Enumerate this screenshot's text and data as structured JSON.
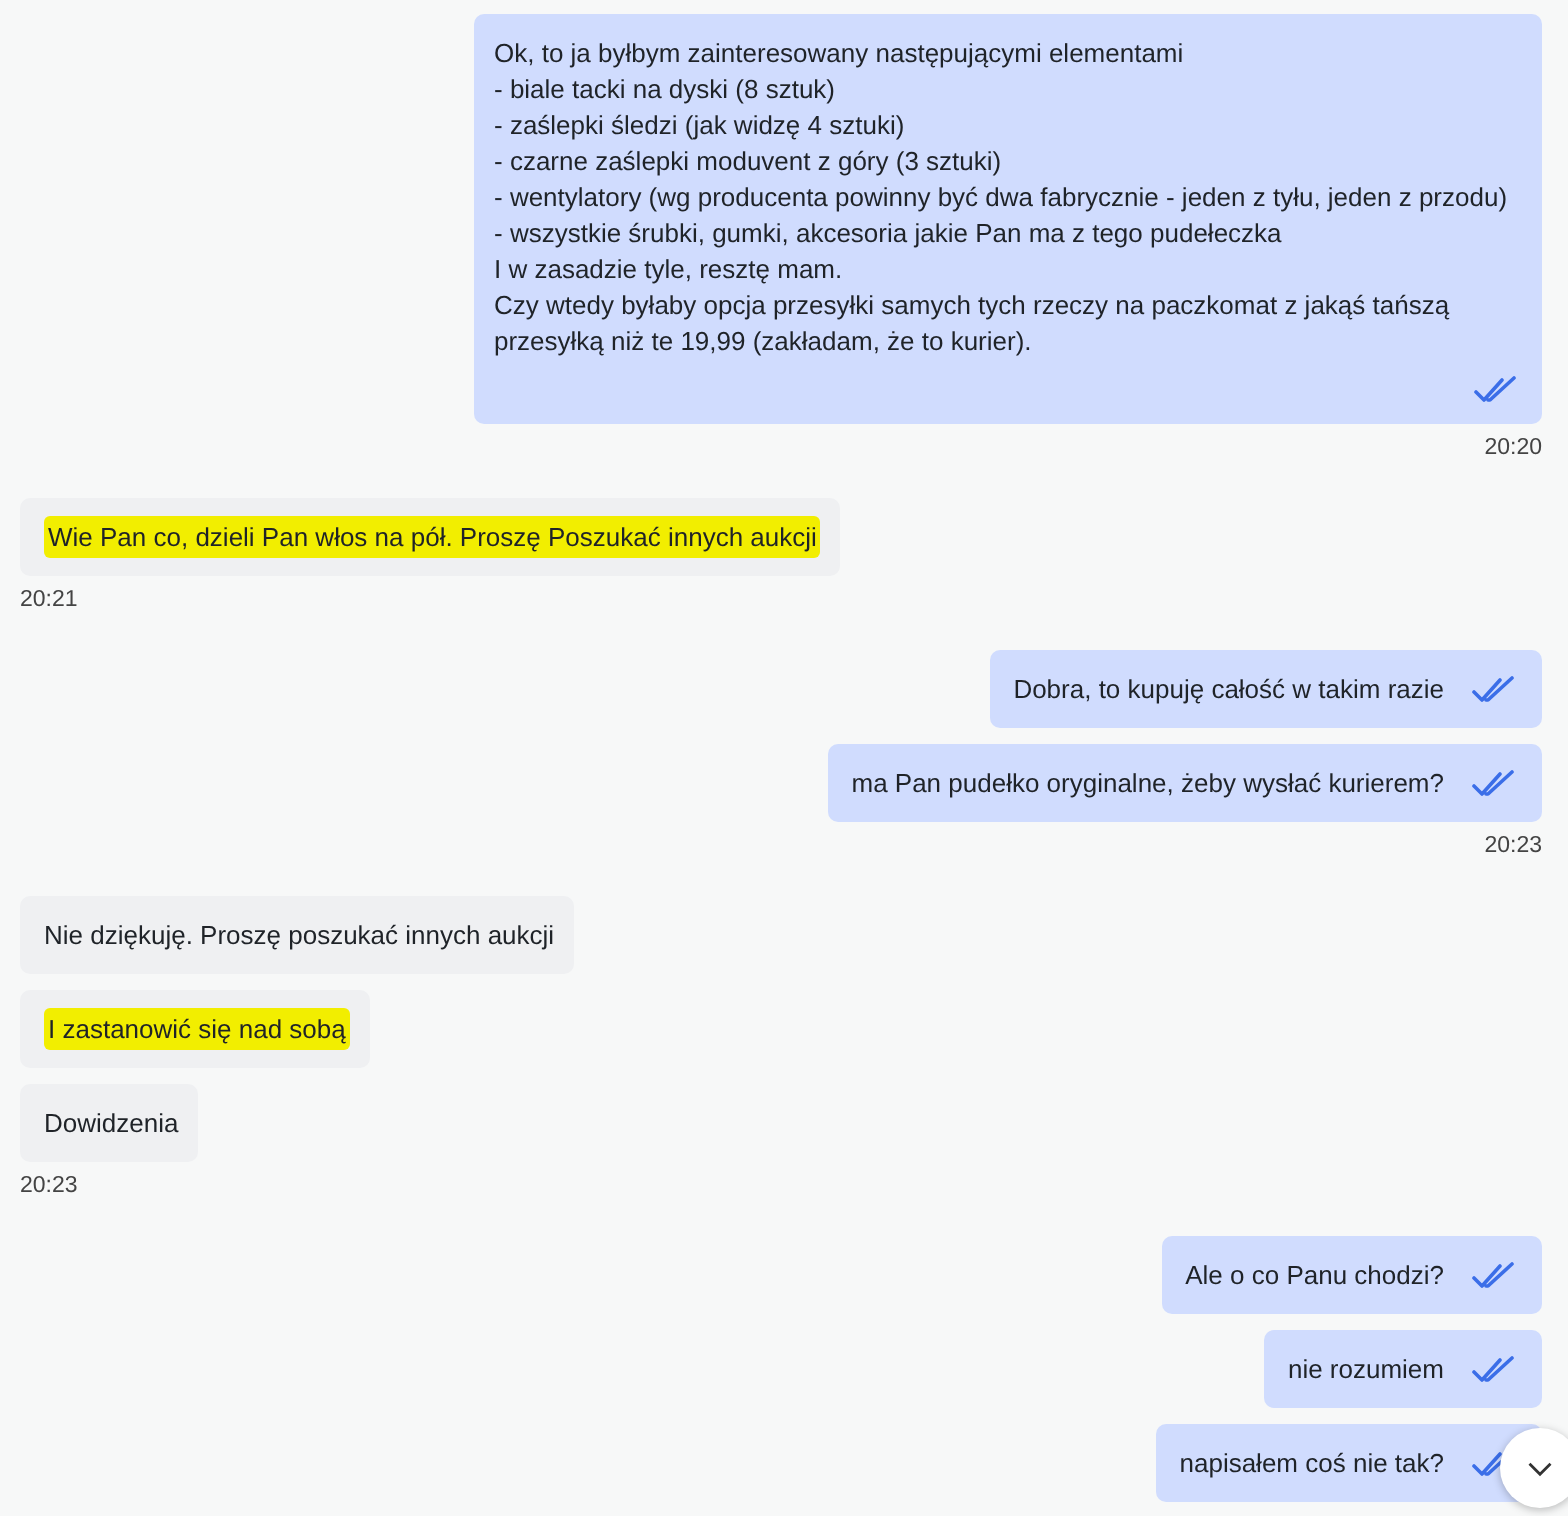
{
  "groups": [
    {
      "kind": "outgoing",
      "time": "20:20",
      "messages": [
        {
          "text": "Ok, to ja byłbym zainteresowany następującymi elementami\n- biale tacki na dyski (8 sztuk)\n- zaślepki śledzi (jak widzę 4 sztuki)\n- czarne zaślepki moduvent z góry (3 sztuki)\n- wentylatory (wg producenta powinny być dwa fabrycznie - jeden z tyłu, jeden z przodu)\n- wszystkie śrubki, gumki, akcesoria jakie Pan ma z tego pudełeczka\nI w zasadzie tyle, resztę mam.\nCzy wtedy byłaby opcja przesyłki samych tych rzeczy na paczkomat z jakąś tańszą przesyłką niż te 19,99 (zakładam, że to kurier).",
          "highlighted": false,
          "read": true
        }
      ]
    },
    {
      "kind": "incoming",
      "time": "20:21",
      "messages": [
        {
          "text": "Wie Pan co, dzieli Pan włos na pół. Proszę Poszukać innych aukcji",
          "highlighted": true
        }
      ]
    },
    {
      "kind": "outgoing",
      "time": "20:23",
      "messages": [
        {
          "text": "Dobra, to kupuję całość w takim razie",
          "highlighted": false,
          "read": true
        },
        {
          "text": "ma Pan pudełko oryginalne, żeby wysłać kurierem?",
          "highlighted": false,
          "read": true
        }
      ]
    },
    {
      "kind": "incoming",
      "time": "20:23",
      "messages": [
        {
          "text": "Nie dziękuję. Proszę poszukać innych aukcji",
          "highlighted": false
        },
        {
          "text": "I zastanowić się nad sobą",
          "highlighted": true
        },
        {
          "text": "Dowidzenia",
          "highlighted": false
        }
      ]
    },
    {
      "kind": "outgoing",
      "messages": [
        {
          "text": "Ale o co Panu chodzi?",
          "highlighted": false,
          "read": true
        },
        {
          "text": "nie rozumiem",
          "highlighted": false,
          "read": true
        },
        {
          "text": "napisałem coś nie tak?",
          "highlighted": false,
          "read": true
        }
      ]
    }
  ]
}
